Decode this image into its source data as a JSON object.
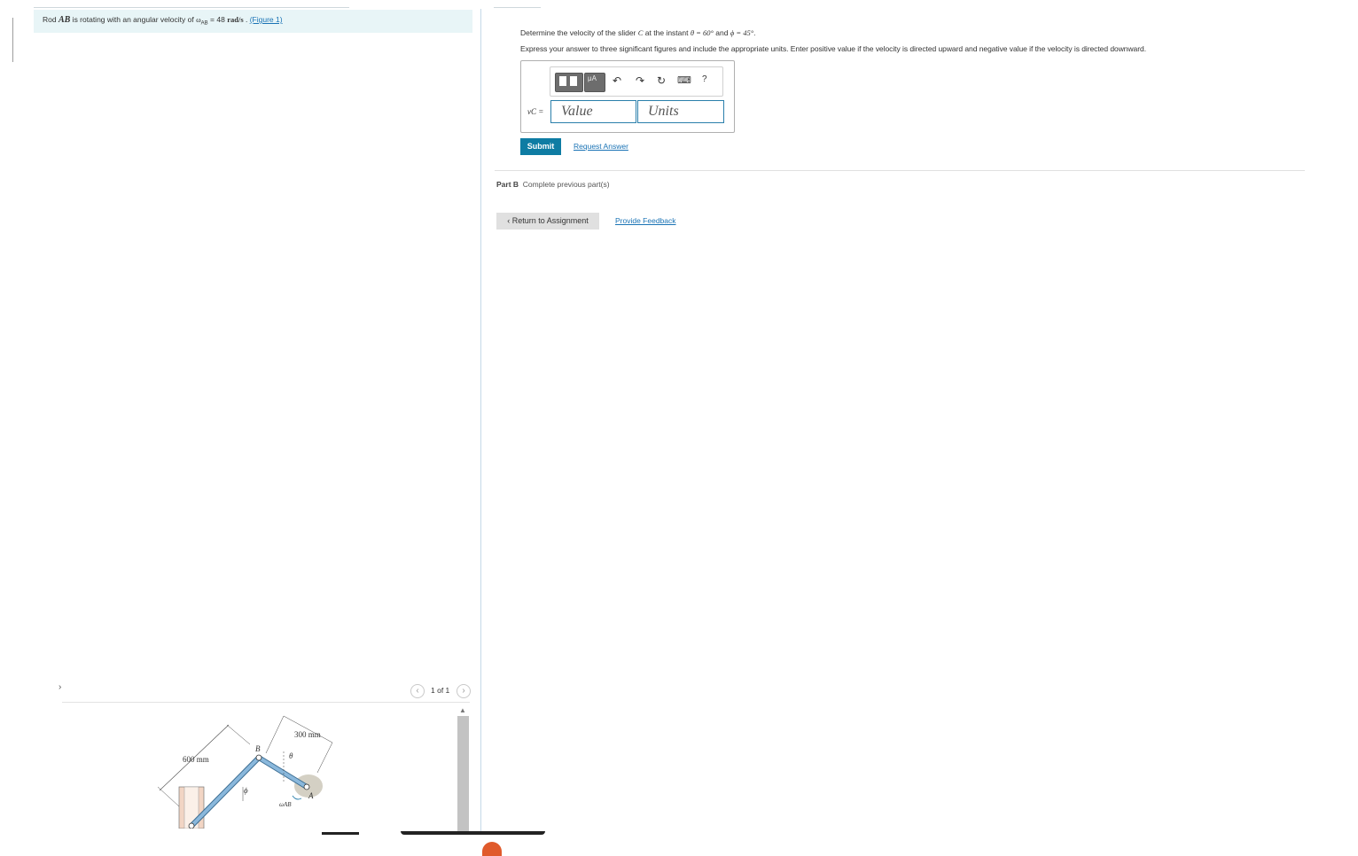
{
  "problem": {
    "prefix": "Rod ",
    "rod": "AB",
    "middle": " is rotating with an angular velocity of ",
    "omega_symbol": "ω",
    "omega_sub": "AB",
    "value_text": " = 48 ",
    "unit": "rad/s",
    "after": " . ",
    "figure_link": "(Figure 1)"
  },
  "partA": {
    "question_prefix": "Determine the velocity of the slider ",
    "slider": "C",
    "question_middle": " at the instant ",
    "theta_expr": "θ = 60°",
    "and": " and ",
    "phi_expr": "ϕ = 45°",
    "question_end": ".",
    "instructions": "Express your answer to three significant figures and include the appropriate units. Enter positive value if the velocity is directed upward and negative value if the velocity is directed downward.",
    "answer_label": "vC =",
    "value_placeholder": "Value",
    "units_placeholder": "Units",
    "toolbar": {
      "units_button": "μA",
      "undo_icon": "↶",
      "redo_icon": "↷",
      "reset_icon": "↻",
      "keyboard_icon": "⌨",
      "help_icon": "?"
    },
    "submit": "Submit",
    "request_answer": "Request Answer"
  },
  "partB": {
    "label": "Part B",
    "text": "Complete previous part(s)"
  },
  "nav": {
    "return": "Return to Assignment",
    "feedback": "Provide Feedback"
  },
  "figure": {
    "pager": "1 of 1",
    "prev_icon": "‹",
    "next_icon": "›",
    "labels": {
      "dim_left": "600 mm",
      "dim_right": "300 mm",
      "b": "B",
      "a": "A",
      "theta": "θ",
      "phi": "ϕ",
      "omega": "ωAB"
    }
  },
  "colors": {
    "accent": "#0e7ca3",
    "link": "#1a73b5",
    "banner": "#e8f5f7",
    "rod": "#8ab8dc"
  }
}
